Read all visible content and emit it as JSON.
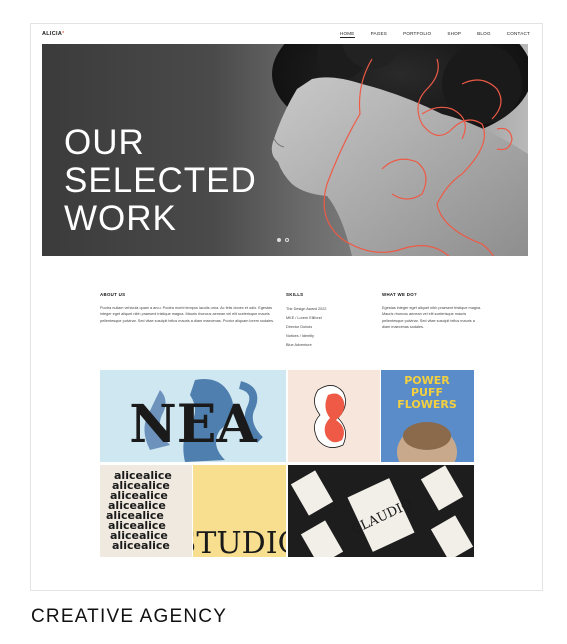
{
  "header": {
    "logo": "ALICIA",
    "logo_dot": "°",
    "nav": [
      "HOME",
      "PAGES",
      "PORTFOLIO",
      "SHOP",
      "BLOG",
      "CONTACT"
    ]
  },
  "hero": {
    "title_lines": [
      "OUR",
      "SELECTED",
      "WORK"
    ]
  },
  "info": {
    "about": {
      "heading": "ABOUT US",
      "text": "Pootra nullam vehicula quam a arcu. Pootra morbi tempus iaculis urna. Ac felis donec et odio. Egestas integer eget aliquet nibh praesent tristique magna. Mauris rhoncus aenean vel elit scelerisque mauris pellentesque pulvinar. Sed vitae suscipit tellus mauris a diam maecenas. Pootor aliquam lorem sodales."
    },
    "skills": {
      "heading": "SKILLS",
      "items": [
        "The Design Award 2022",
        "MKE / Lorem Ellifond",
        "Director Dubois",
        "Notices / Identity",
        "Blue Adventure"
      ]
    },
    "what": {
      "heading": "WHAT WE DO?",
      "text": "Egestas integer eget aliquet nibh praesent tristique magna. Mauris rhoncus aenean vel elit scelerisque mauris pellentesque pulvinar. Sed vitae suscipit tellus mauris a diam maecenas sodales."
    }
  },
  "gallery": {
    "tile1_text": "NEA",
    "tile3_text": [
      "POWER",
      "PUFF",
      "FLOWERS"
    ],
    "tile4_text": "alicealice",
    "tile5_text": "STUDIO",
    "tile6_text": "CLAUDIO"
  },
  "caption": "CREATIVE AGENCY"
}
